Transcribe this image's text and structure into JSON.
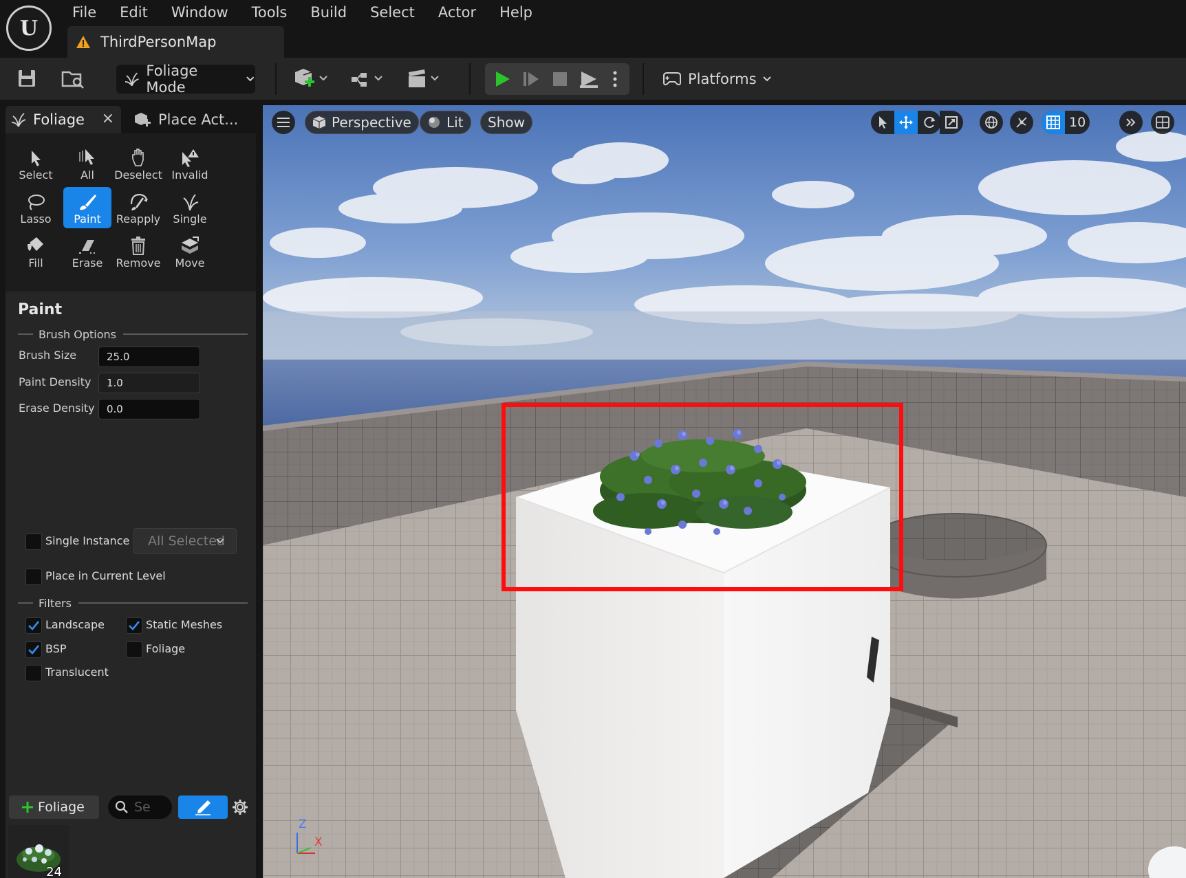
{
  "app": {
    "logo_letter": "U"
  },
  "menu": [
    "File",
    "Edit",
    "Window",
    "Tools",
    "Build",
    "Select",
    "Actor",
    "Help"
  ],
  "map_tab": {
    "label": "ThirdPersonMap"
  },
  "toolbar": {
    "mode_label": "Foliage Mode",
    "platforms_label": "Platforms"
  },
  "panel_tabs": {
    "foliage": "Foliage",
    "close": "×",
    "place_actors": "Place Act..."
  },
  "tools": [
    {
      "label": "Select",
      "icon": "select-arrow-icon"
    },
    {
      "label": "All",
      "icon": "select-all-icon"
    },
    {
      "label": "Deselect",
      "icon": "deselect-hand-icon"
    },
    {
      "label": "Invalid",
      "icon": "invalid-icon"
    },
    {
      "label": "Lasso",
      "icon": "lasso-icon"
    },
    {
      "label": "Paint",
      "icon": "paint-brush-icon",
      "active": true
    },
    {
      "label": "Reapply",
      "icon": "reapply-icon"
    },
    {
      "label": "Single",
      "icon": "single-icon"
    },
    {
      "label": "Fill",
      "icon": "fill-bucket-icon"
    },
    {
      "label": "Erase",
      "icon": "eraser-icon"
    },
    {
      "label": "Remove",
      "icon": "trash-icon"
    },
    {
      "label": "Move",
      "icon": "move-icon"
    }
  ],
  "paint": {
    "title": "Paint",
    "brush_options_label": "Brush Options",
    "brush_size_label": "Brush Size",
    "brush_size_value": "25.0",
    "paint_density_label": "Paint Density",
    "paint_density_value": "1.0",
    "erase_density_label": "Erase Density",
    "erase_density_value": "0.0",
    "single_instance_label": "Single Instance Mode",
    "single_instance_dropdown": "All Selected",
    "place_current_level_label": "Place in Current Level",
    "filters_label": "Filters",
    "filters": {
      "landscape": {
        "label": "Landscape",
        "checked": true
      },
      "static_meshes": {
        "label": "Static Meshes",
        "checked": true
      },
      "bsp": {
        "label": "BSP",
        "checked": true
      },
      "foliage": {
        "label": "Foliage",
        "checked": false
      },
      "translucent": {
        "label": "Translucent",
        "checked": false
      }
    }
  },
  "foliage_list": {
    "add_label": "Foliage",
    "search_placeholder": "Se",
    "items": [
      {
        "count": "24",
        "icon": "hydrangea-thumbnail-icon"
      }
    ]
  },
  "viewport": {
    "perspective_label": "Perspective",
    "lit_label": "Lit",
    "show_label": "Show",
    "grid_snap_value": "10",
    "axis": {
      "z": "Z",
      "x": "X"
    }
  },
  "colors": {
    "accent": "#1a85e8",
    "play_green": "#2cc42c",
    "highlight_red": "#ff0d0d"
  }
}
